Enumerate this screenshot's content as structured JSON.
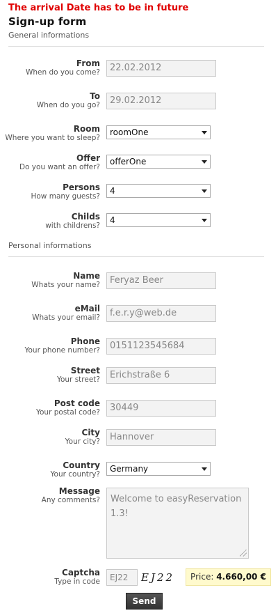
{
  "error_message": "The arrival Date has to be in future",
  "form_title": "Sign-up form",
  "sections": {
    "general": "General informations",
    "personal": "Personal informations"
  },
  "fields": {
    "from": {
      "label": "From",
      "hint": "When do you come?",
      "value": "22.02.2012"
    },
    "to": {
      "label": "To",
      "hint": "When do you go?",
      "value": "29.02.2012"
    },
    "room": {
      "label": "Room",
      "hint": "Where you want to sleep?",
      "value": "roomOne"
    },
    "offer": {
      "label": "Offer",
      "hint": "Do you want an offer?",
      "value": "offerOne"
    },
    "persons": {
      "label": "Persons",
      "hint": "How many guests?",
      "value": "4"
    },
    "childs": {
      "label": "Childs",
      "hint": "with childrens?",
      "value": "4"
    },
    "name": {
      "label": "Name",
      "hint": "Whats your name?",
      "value": "Feryaz Beer"
    },
    "email": {
      "label": "eMail",
      "hint": "Whats your email?",
      "value": "f.e.r.y@web.de"
    },
    "phone": {
      "label": "Phone",
      "hint": "Your phone number?",
      "value": "0151123545684"
    },
    "street": {
      "label": "Street",
      "hint": "Your street?",
      "value": "Erichstraße 6"
    },
    "postcode": {
      "label": "Post code",
      "hint": "Your postal code?",
      "value": "30449"
    },
    "city": {
      "label": "City",
      "hint": "Your city?",
      "value": "Hannover"
    },
    "country": {
      "label": "Country",
      "hint": "Your country?",
      "value": "Germany"
    },
    "message": {
      "label": "Message",
      "hint": "Any comments?",
      "value": "Welcome to easyReservation 1.3!"
    },
    "captcha": {
      "label": "Captcha",
      "hint": "Type in code",
      "value": "EJ22",
      "image_text": "EJ22"
    }
  },
  "price": {
    "label": "Price:",
    "amount": "4.660,00 €"
  },
  "send_label": "Send",
  "colors": {
    "error": "#e00000",
    "price_bg": "#fffacd",
    "button_bg": "#444444"
  }
}
